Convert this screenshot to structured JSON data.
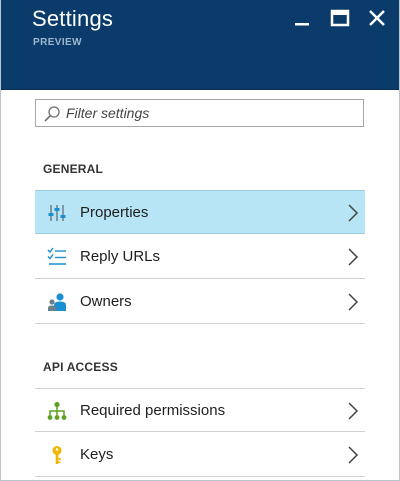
{
  "header": {
    "title": "Settings",
    "subtitle": "PREVIEW",
    "colors": {
      "background": "#0b3b6b",
      "title": "#ffffff",
      "subtitle": "#9fb6cf"
    },
    "window_controls": [
      "minimize-icon",
      "maximize-icon",
      "close-icon"
    ]
  },
  "filter": {
    "placeholder": "Filter settings",
    "value": "",
    "icon": "search-icon"
  },
  "sections": {
    "general": {
      "title": "GENERAL",
      "items": [
        {
          "label": "Properties",
          "icon": "properties-sliders-icon",
          "selected": true
        },
        {
          "label": "Reply URLs",
          "icon": "list-checks-icon",
          "selected": false
        },
        {
          "label": "Owners",
          "icon": "owners-icon",
          "selected": false
        }
      ]
    },
    "api_access": {
      "title": "API ACCESS",
      "items": [
        {
          "label": "Required permissions",
          "icon": "hierarchy-icon",
          "selected": false
        },
        {
          "label": "Keys",
          "icon": "key-icon",
          "selected": false
        }
      ]
    }
  },
  "colors": {
    "selected_row": "#b7e5f5",
    "icon_blue": "#1a8fd1",
    "icon_green": "#5ea225",
    "icon_yellow": "#f2b500"
  }
}
